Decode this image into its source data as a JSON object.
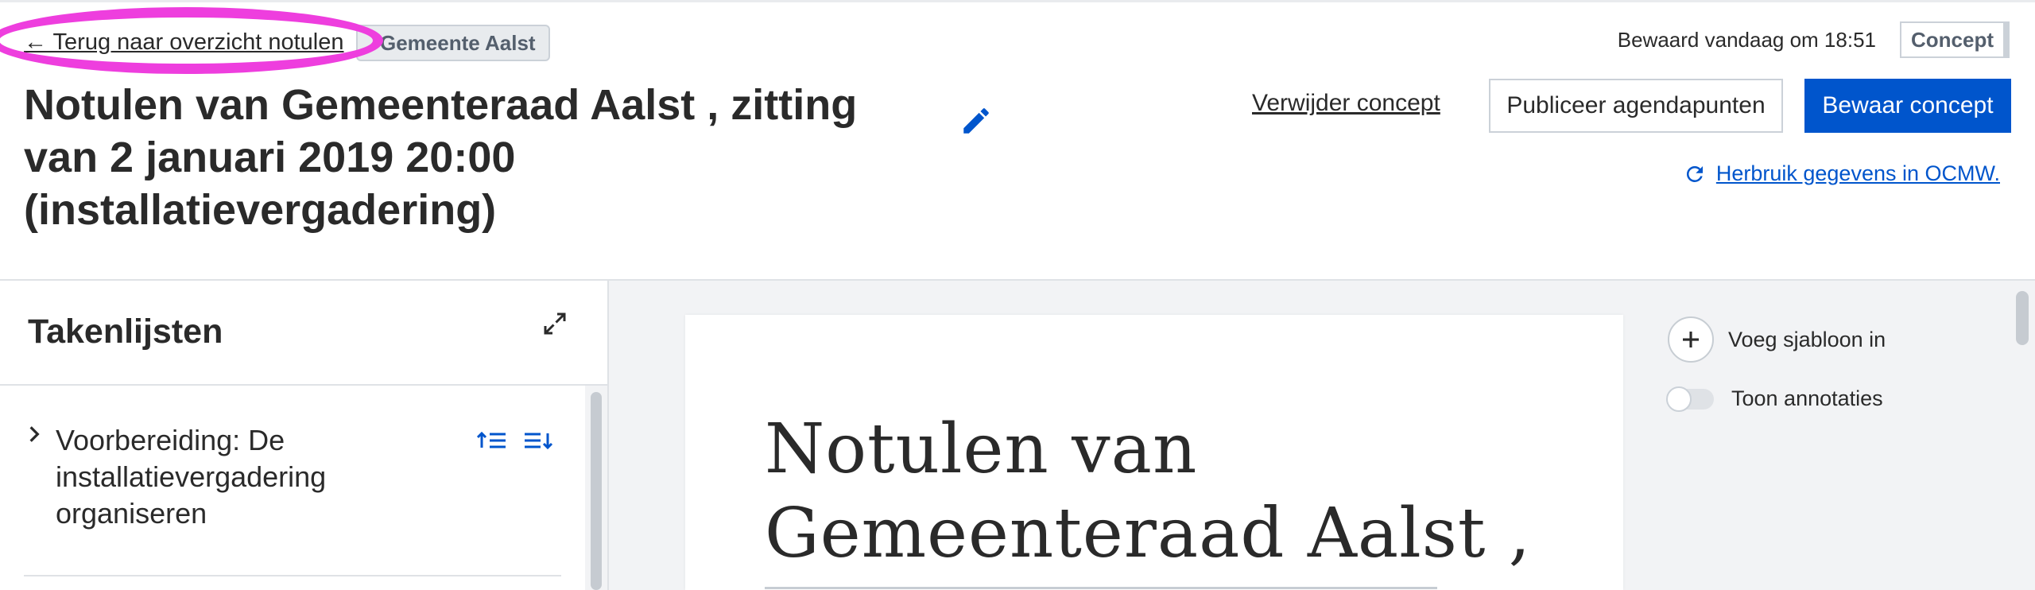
{
  "header": {
    "back_link": "← Terug naar overzicht notulen",
    "admin_unit": "Gemeente Aalst",
    "title": "Notulen van Gemeenteraad Aalst , zitting van 2 januari 2019 20:00 (installatievergadering)",
    "saved_status": "Bewaard vandaag om 18:51",
    "status_badge": "Concept",
    "delete_label": "Verwijder concept",
    "publish_label": "Publiceer agendapunten",
    "save_label": "Bewaar concept",
    "reuse_label": "Herbruik gegevens in OCMW."
  },
  "sidebar": {
    "title": "Takenlijsten",
    "tasks": [
      {
        "label": "Voorbereiding: De installatievergadering organiseren"
      }
    ]
  },
  "editor": {
    "document_title": "Notulen van Gemeenteraad Aalst  ,"
  },
  "tools": {
    "template_label": "Voeg sjabloon in",
    "annotations_label": "Toon annotaties",
    "annotations_on": false
  },
  "colors": {
    "primary": "#0055cc",
    "highlight": "#ee3ede",
    "editor_background": "#f2f3f5"
  },
  "icons": {
    "edit": "pencil-icon",
    "reuse": "refresh-icon",
    "expand": "expand-icon",
    "chevron": "chevron-right-icon",
    "sort_up": "sort-up-icon",
    "sort_down": "sort-down-icon",
    "add": "plus-icon"
  }
}
